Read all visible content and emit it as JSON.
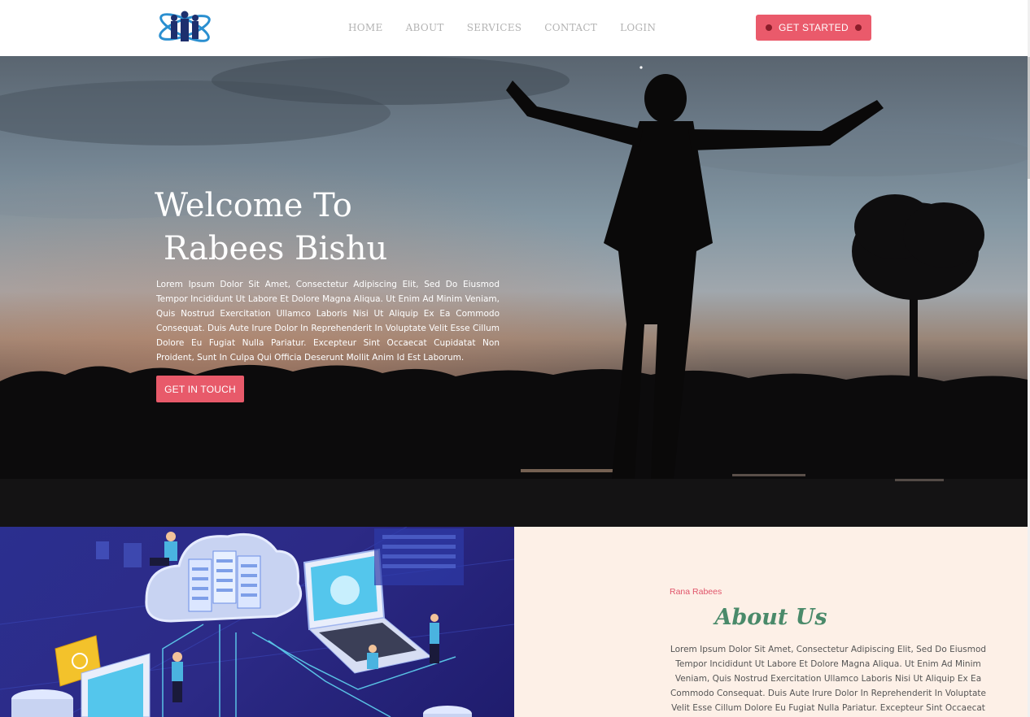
{
  "header": {
    "logo": "team-atom-logo",
    "nav": [
      "HOME",
      "ABOUT",
      "SERVICES",
      "CONTACT",
      "LOGIN"
    ],
    "cta_label": "GET STARTED"
  },
  "hero": {
    "title_line1": "Welcome To",
    "title_line2": "Rabees Bishu",
    "paragraph": "Lorem Ipsum Dolor Sit Amet, Consectetur Adipiscing Elit, Sed Do Eiusmod Tempor Incididunt Ut Labore Et Dolore Magna Aliqua. Ut Enim Ad Minim Veniam, Quis Nostrud Exercitation Ullamco Laboris Nisi Ut Aliquip Ex Ea Commodo Consequat. Duis Aute Irure Dolor In Reprehenderit In Voluptate Velit Esse Cillum Dolore Eu Fugiat Nulla Pariatur. Excepteur Sint Occaecat Cupidatat Non Proident, Sunt In Culpa Qui Officia Deserunt Mollit Anim Id Est Laborum.",
    "button_label": "GET IN TOUCH"
  },
  "about": {
    "subtitle": "Rana Rabees",
    "title": "About Us",
    "paragraph": "Lorem Ipsum Dolor Sit Amet, Consectetur Adipiscing Elit, Sed Do Eiusmod Tempor Incididunt Ut Labore Et Dolore Magna Aliqua. Ut Enim Ad Minim Veniam, Quis Nostrud Exercitation Ullamco Laboris Nisi Ut Aliquip Ex Ea Commodo Consequat. Duis Aute Irure Dolor In Reprehenderit In Voluptate Velit Esse Cillum Dolore Eu Fugiat Nulla Pariatur. Excepteur Sint Occaecat Cupidatat"
  },
  "colors": {
    "accent": "#e85a6a",
    "about_bg": "#fdf0e7",
    "about_title": "#4a8a6a",
    "illustration_bg": "#2b2f8f"
  }
}
